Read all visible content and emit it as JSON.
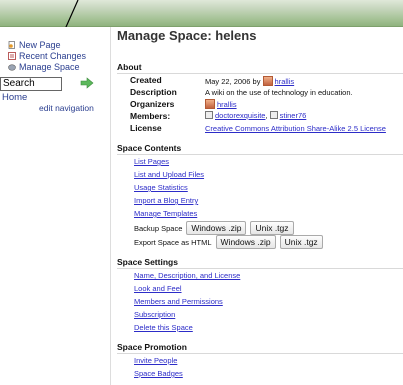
{
  "sidebar": {
    "new_page": "New Page",
    "recent_changes": "Recent Changes",
    "manage_space": "Manage Space",
    "search_value": "Search",
    "home": "Home",
    "edit_navigation": "edit navigation"
  },
  "main": {
    "title": "Manage Space: helens",
    "about": {
      "heading": "About",
      "created_label": "Created",
      "created_value": "May 22, 2006 by",
      "created_user": "hrallis",
      "description_label": "Description",
      "description_value": "A wiki on the use of technology in education.",
      "organizers_label": "Organizers",
      "organizer": "hrallis",
      "members_label": "Members:",
      "member1": "doctorexquisite",
      "member2": "stiner76",
      "license_label": "License",
      "license_value": "Creative Commons Attribution Share-Alike 2.5 License"
    },
    "contents": {
      "heading": "Space Contents",
      "list_pages": "List Pages",
      "list_upload": "List and Upload Files",
      "usage": "Usage Statistics",
      "import_blog": "Import a Blog Entry",
      "manage_templates": "Manage Templates",
      "backup_label": "Backup Space",
      "export_label": "Export Space as HTML",
      "zip_label": "Windows .zip",
      "tgz_label": "Unix .tgz"
    },
    "settings": {
      "heading": "Space Settings",
      "name_desc": "Name, Description, and License",
      "look": "Look and Feel",
      "members": "Members and Permissions",
      "subscription": "Subscription",
      "delete": "Delete this Space"
    },
    "promotion": {
      "heading": "Space Promotion",
      "invite": "Invite People",
      "badges": "Space Badges"
    }
  }
}
